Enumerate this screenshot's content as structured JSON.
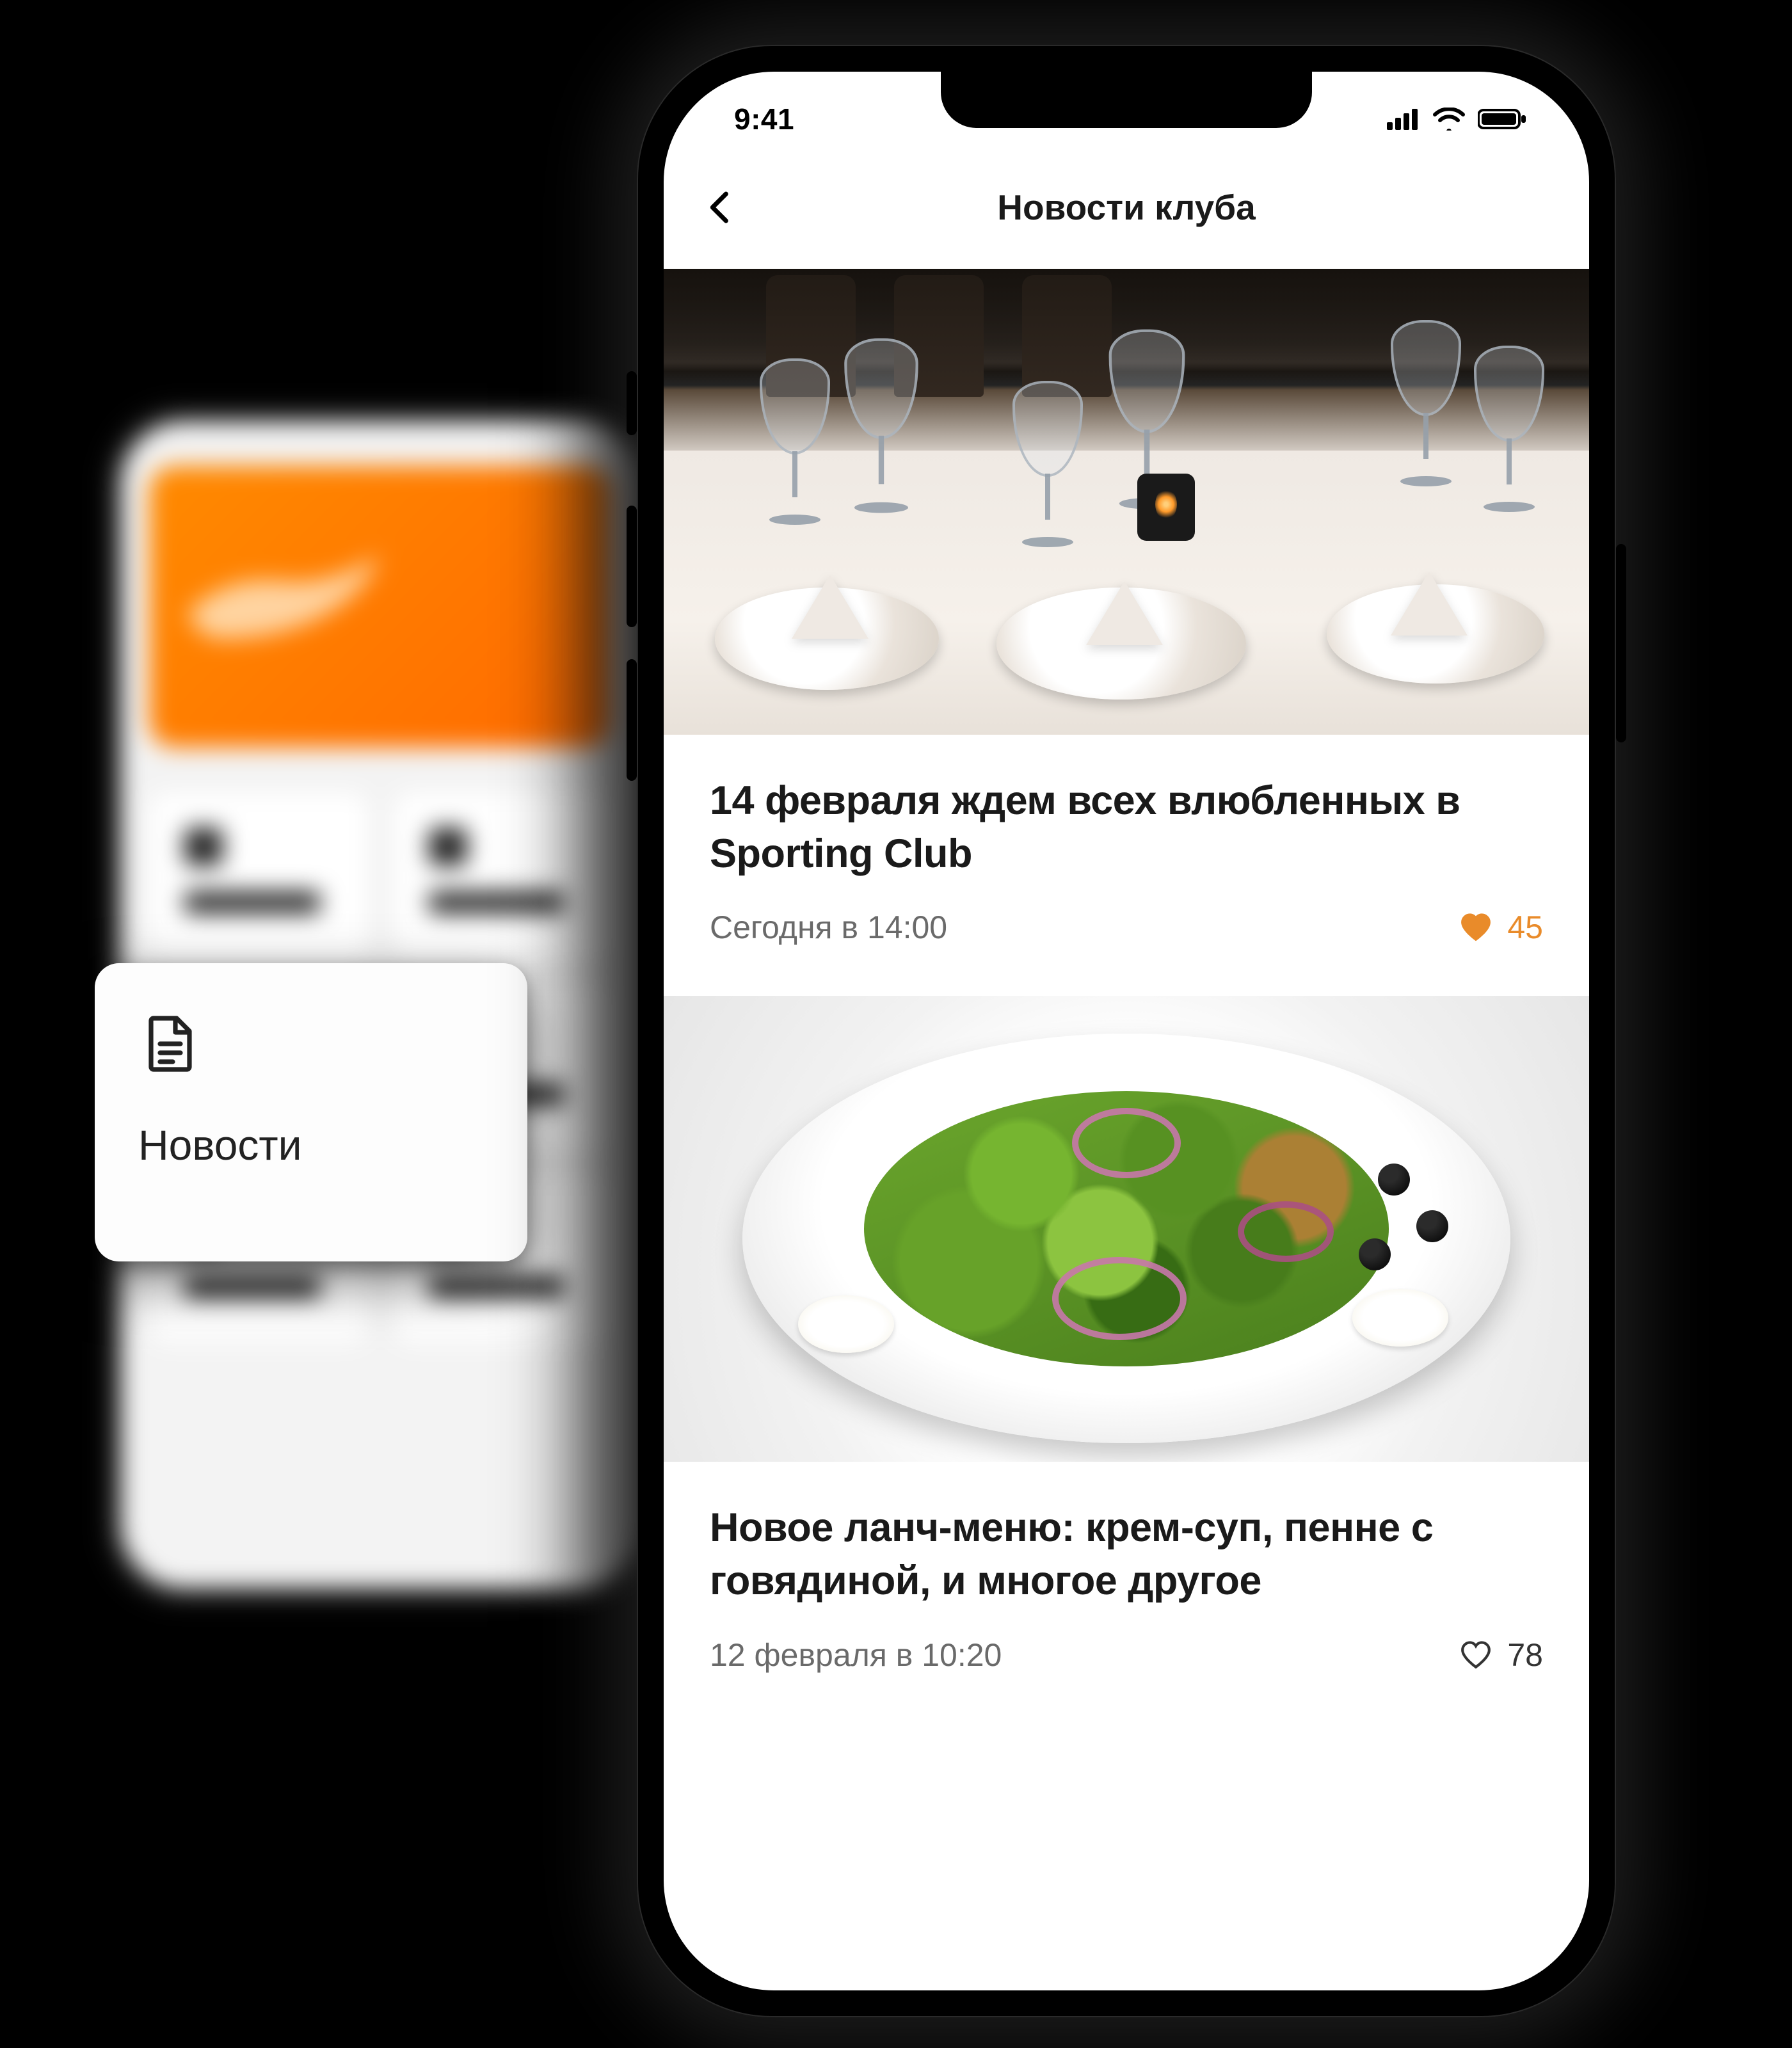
{
  "tile": {
    "label": "Новости",
    "icon": "news-document-icon"
  },
  "statusbar": {
    "time": "9:41",
    "icons": {
      "signal": "cellular-signal-icon",
      "wifi": "wifi-icon",
      "battery": "battery-icon"
    }
  },
  "header": {
    "back_icon": "chevron-left-icon",
    "title": "Новости клуба"
  },
  "feed": [
    {
      "image": "restaurant-table-setting",
      "title": "14 февраля ждем всех влюбленных в Sporting Club",
      "date": "Сегодня в 14:00",
      "likes": 45,
      "liked": true
    },
    {
      "image": "salad-dish",
      "title": "Новое ланч-меню: крем-суп, пенне с говядиной, и многое другое",
      "date": "12 февраля в 10:20",
      "likes": 78,
      "liked": false
    }
  ],
  "colors": {
    "accent": "#e98b2a",
    "text": "#1a1a1a",
    "muted": "#6a6a6a"
  }
}
